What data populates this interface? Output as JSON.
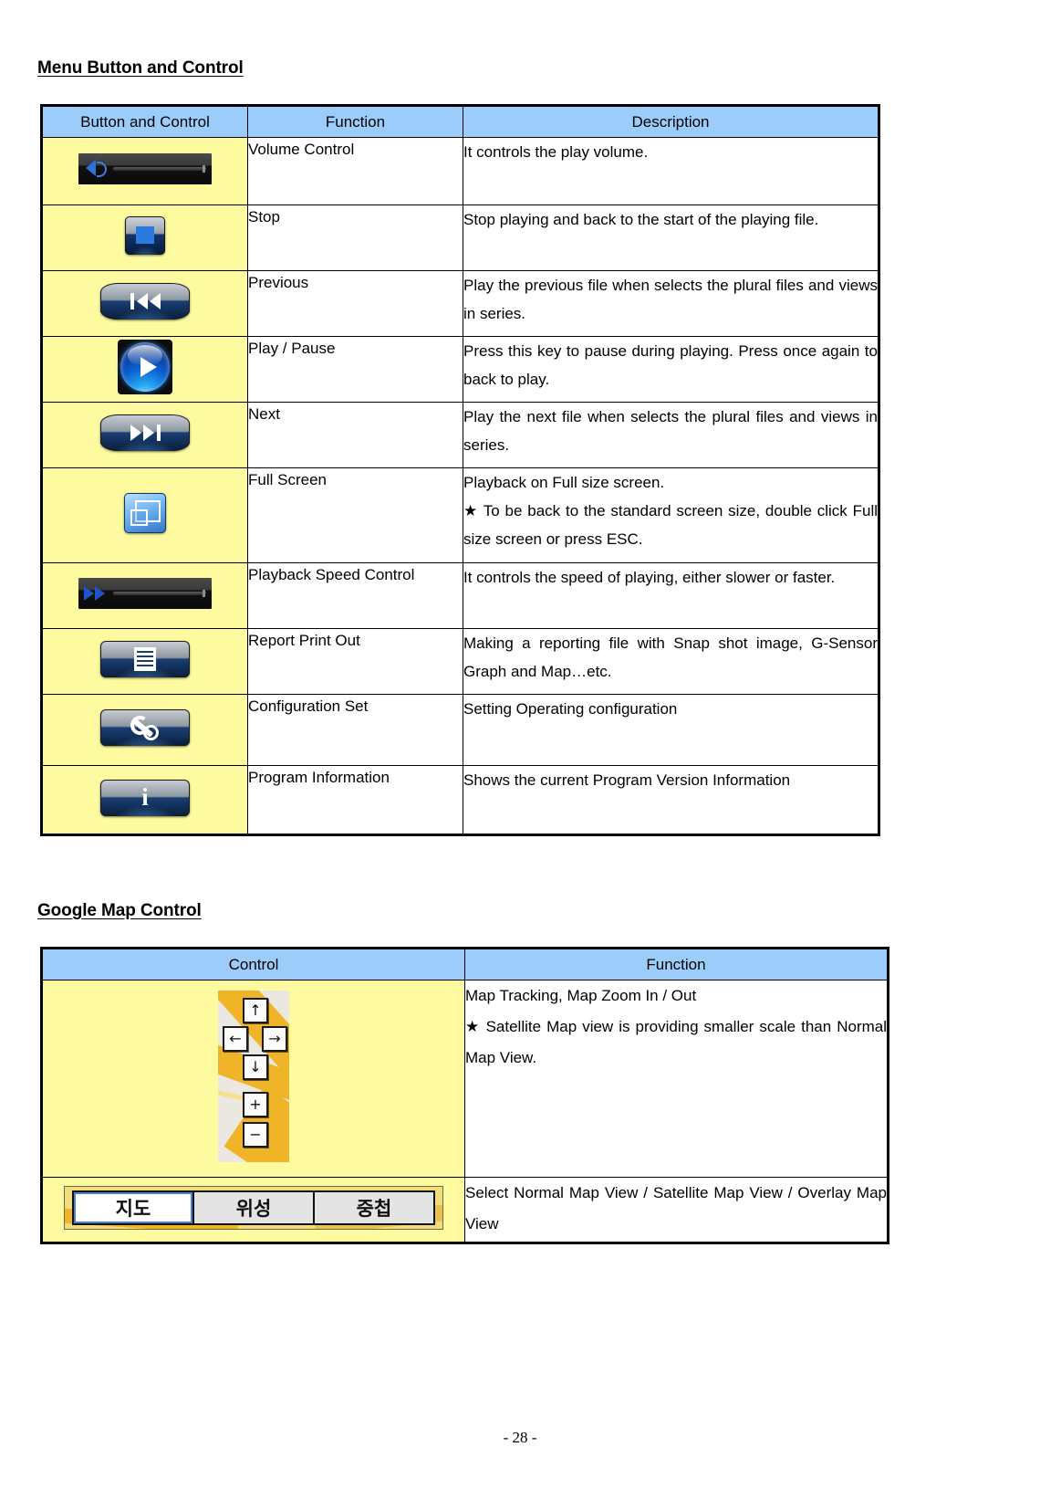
{
  "document": {
    "page_number": "- 28 -"
  },
  "sections": {
    "menu": {
      "heading": "Menu Button and Control",
      "headers": [
        "Button and Control",
        "Function",
        "Description"
      ],
      "rows": [
        {
          "icon": "volume-slider-icon",
          "function": "Volume Control",
          "description": [
            "It controls the play volume."
          ]
        },
        {
          "icon": "stop-button-icon",
          "function": "Stop",
          "description": [
            "Stop playing and back to the start of the playing file."
          ]
        },
        {
          "icon": "previous-button-icon",
          "function": "Previous",
          "description": [
            "Play the previous file when selects the plural files and views in series."
          ]
        },
        {
          "icon": "play-pause-button-icon",
          "function": "Play / Pause",
          "description": [
            "Press this key to pause during playing. Press once again to back to play."
          ]
        },
        {
          "icon": "next-button-icon",
          "function": "Next",
          "description": [
            "Play the next file when selects the plural files and views in series."
          ]
        },
        {
          "icon": "full-screen-button-icon",
          "function": "Full Screen",
          "description_line1": "Playback on Full size screen.",
          "description_line2": "★ To be back to the standard screen size, double click Full size screen or press ESC."
        },
        {
          "icon": "playback-speed-slider-icon",
          "function": "Playback Speed Control",
          "description": [
            "It controls the speed of playing, either slower or faster."
          ]
        },
        {
          "icon": "report-print-button-icon",
          "function": "Report Print Out",
          "description": [
            "Making a reporting file with Snap shot image, G-Sensor Graph and Map…etc."
          ]
        },
        {
          "icon": "configuration-button-icon",
          "function": "Configuration Set",
          "description": [
            "Setting Operating configuration"
          ]
        },
        {
          "icon": "program-information-button-icon",
          "function": "Program Information",
          "description": [
            "Shows the current Program Version Information"
          ]
        }
      ]
    },
    "map": {
      "heading": "Google Map Control",
      "headers": [
        "Control",
        "Function"
      ],
      "rows": [
        {
          "icon": "map-pan-zoom-control-icon",
          "function_line1": "Map Tracking, Map Zoom In / Out",
          "function_line2": "★ Satellite Map view is providing smaller scale than Normal Map View.",
          "keys": {
            "up": "↑",
            "left": "←",
            "right": "→",
            "down": "↓",
            "zoom_in": "+",
            "zoom_out": "−"
          }
        },
        {
          "icon": "map-type-buttons-icon",
          "function": "Select Normal Map View / Satellite Map View / Overlay Map View",
          "buttons": [
            {
              "label": "지도",
              "selected": true
            },
            {
              "label": "위성",
              "selected": false
            },
            {
              "label": "중첩",
              "selected": false
            }
          ]
        }
      ]
    }
  },
  "colors": {
    "header_blue": "#9ccdfa",
    "icon_cell_yellow": "#fdfaa0",
    "border": "#000000"
  }
}
